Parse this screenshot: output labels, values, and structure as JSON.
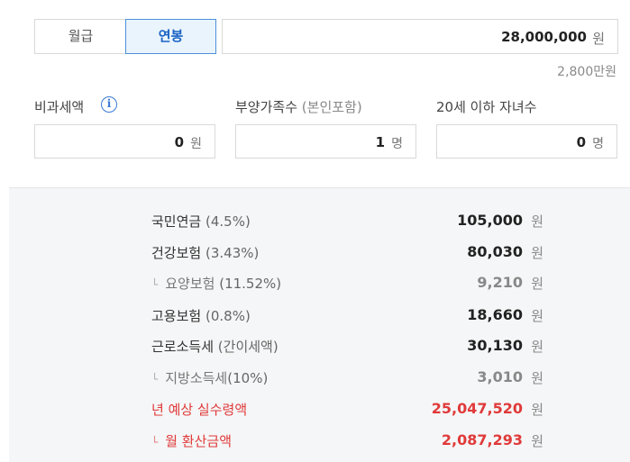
{
  "tabs": {
    "monthly": "월급",
    "annual": "연봉",
    "selected": "annual"
  },
  "salary": {
    "value": "28,000,000",
    "unit": "원",
    "converted": "2,800만원"
  },
  "inputs": {
    "nontaxable": {
      "label": "비과세액",
      "value": "0",
      "unit": "원"
    },
    "dependents": {
      "label": "부양가족수",
      "label_note": "(본인포함)",
      "value": "1",
      "unit": "명"
    },
    "children": {
      "label": "20세 이하 자녀수",
      "value": "0",
      "unit": "명"
    }
  },
  "results": [
    {
      "name": "국민연금",
      "rate": "(4.5%)",
      "amount": "105,000",
      "unit": "원",
      "sub": false
    },
    {
      "name": "건강보험",
      "rate": "(3.43%)",
      "amount": "80,030",
      "unit": "원",
      "sub": false
    },
    {
      "name": "요양보험",
      "rate": "(11.52%)",
      "amount": "9,210",
      "unit": "원",
      "sub": true
    },
    {
      "name": "고용보험",
      "rate": "(0.8%)",
      "amount": "18,660",
      "unit": "원",
      "sub": false
    },
    {
      "name": "근로소득세",
      "rate": "(간이세액)",
      "amount": "30,130",
      "unit": "원",
      "sub": false
    },
    {
      "name": "지방소득세",
      "rate": "(10%)",
      "amount": "3,010",
      "unit": "원",
      "sub": true
    },
    {
      "name": "년 예상 실수령액",
      "rate": "",
      "amount": "25,047,520",
      "unit": "원",
      "sub": false
    },
    {
      "name": "월 환산금액",
      "rate": "",
      "amount": "2,087,293",
      "unit": "원",
      "sub": true
    }
  ],
  "colors": {
    "accent": "#1a63c4",
    "highlight": "#e03a3a"
  }
}
